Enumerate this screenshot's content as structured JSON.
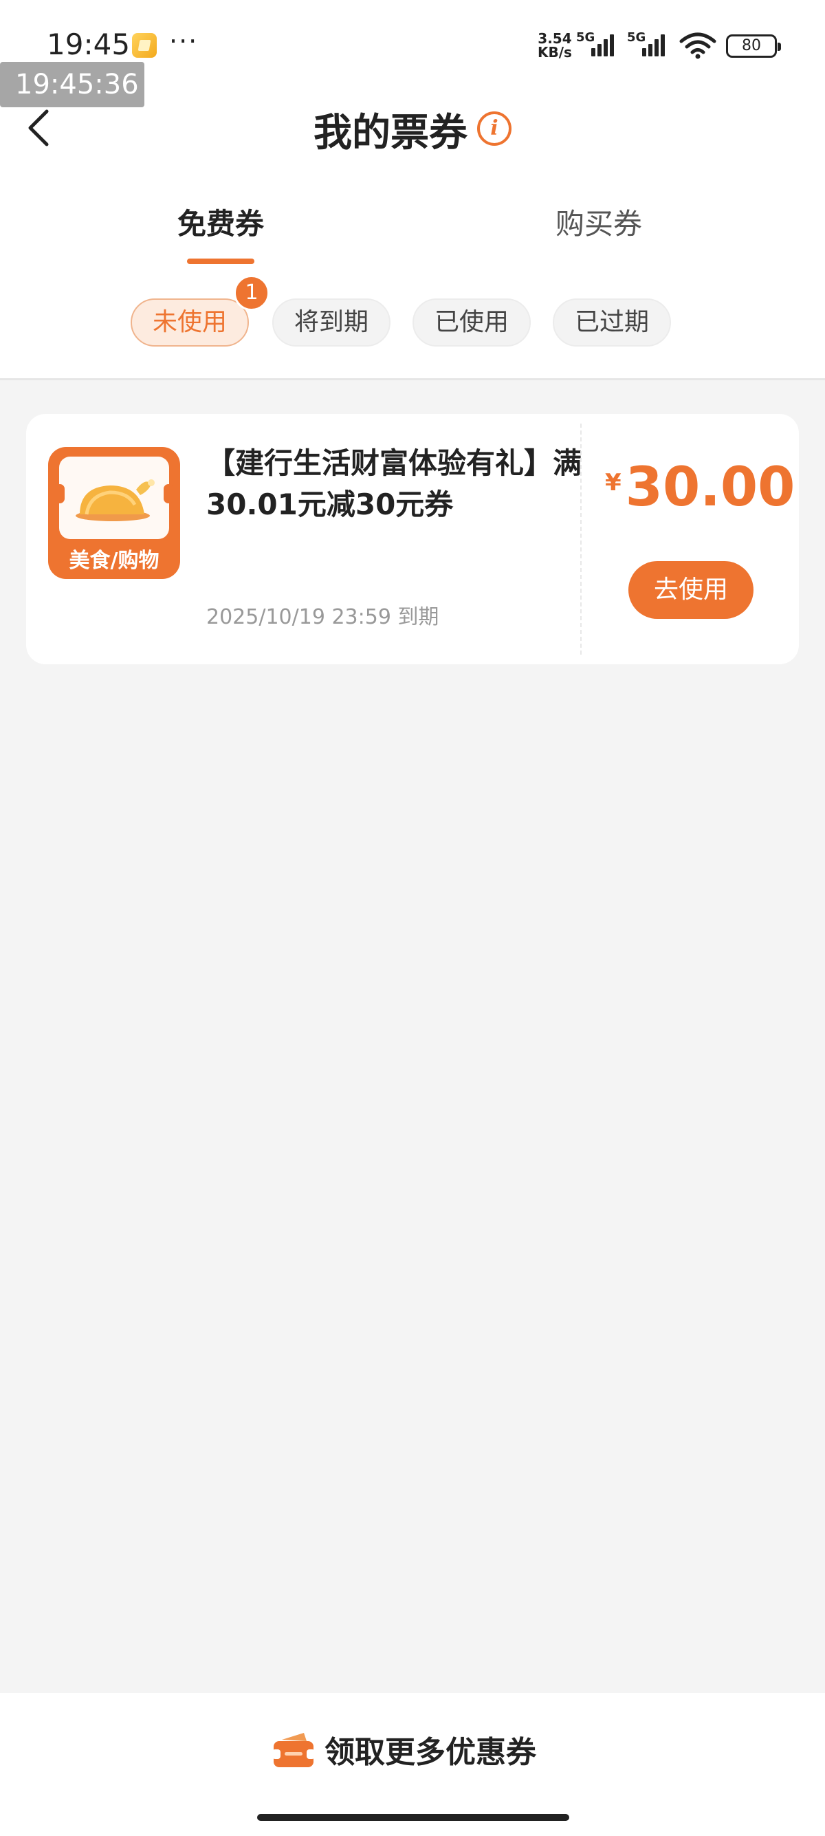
{
  "status_bar": {
    "time": "19:45",
    "more": "···",
    "net_speed_top": "3.54",
    "net_speed_bottom": "KB/s",
    "sim1": "5G",
    "sim2": "5G",
    "battery": "80"
  },
  "overlay_time": "19:45:36",
  "nav": {
    "title": "我的票券",
    "info_icon": "i"
  },
  "tabs": {
    "free": "免费券",
    "purchase": "购买券"
  },
  "filters": {
    "unused": "未使用",
    "expiring": "将到期",
    "used": "已使用",
    "expired": "已过期",
    "unused_badge": "1"
  },
  "coupon": {
    "category": "美食/购物",
    "title": "【建行生活财富体验有礼】满30.01元减30元券",
    "expiry": "2025/10/19 23:59 到期",
    "currency": "¥",
    "amount": "30.00",
    "use_button": "去使用"
  },
  "bottom": {
    "more_coupons": "领取更多优惠券"
  },
  "colors": {
    "accent": "#ee7430",
    "background": "#f4f4f4"
  }
}
